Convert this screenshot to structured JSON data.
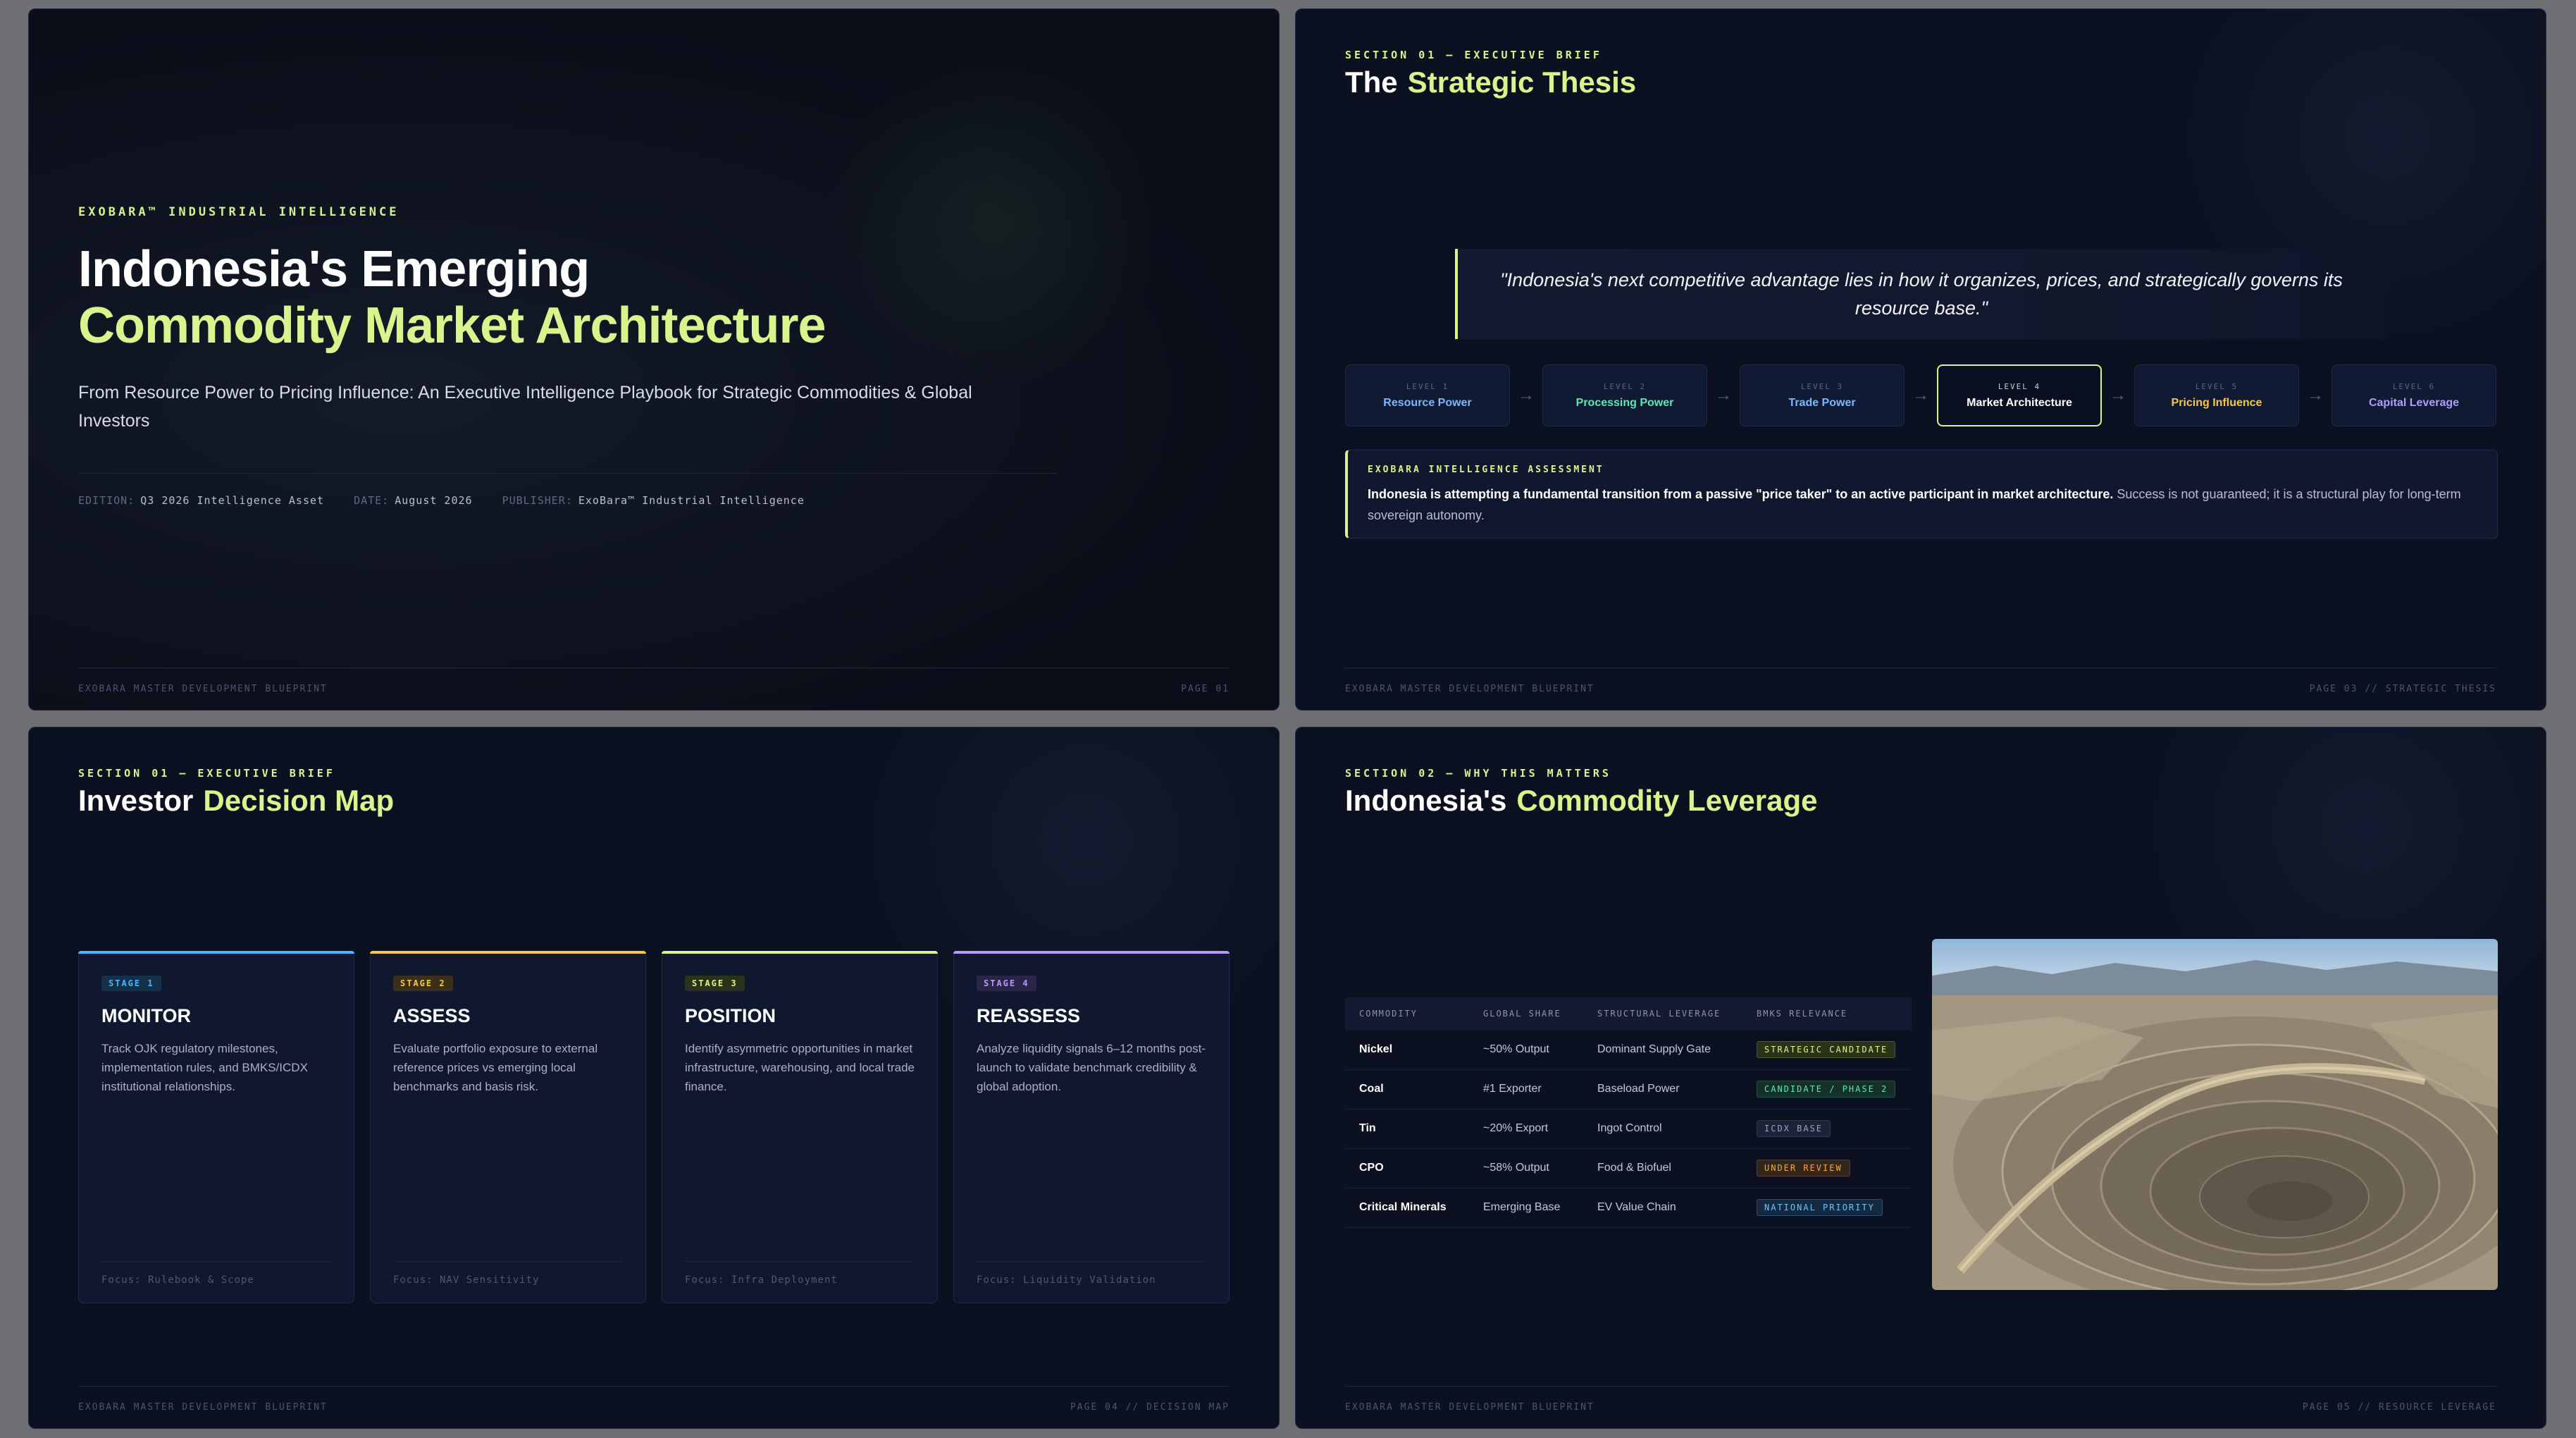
{
  "slide1": {
    "kicker": "EXOBARA™ INDUSTRIAL INTELLIGENCE",
    "title_line1": "Indonesia's Emerging",
    "title_line2": "Commodity Market Architecture",
    "lead": "From Resource Power to Pricing Influence: An Executive Intelligence Playbook for Strategic Commodities & Global Investors",
    "meta": [
      {
        "key": "EDITION:",
        "value": "Q3 2026 Intelligence Asset"
      },
      {
        "key": "DATE:",
        "value": "August 2026"
      },
      {
        "key": "PUBLISHER:",
        "value": "ExoBara™ Industrial Intelligence"
      }
    ],
    "footer_left": "EXOBARA MASTER DEVELOPMENT BLUEPRINT",
    "footer_right": "PAGE 01"
  },
  "slide2": {
    "kicker": "SECTION 01 — EXECUTIVE BRIEF",
    "title": "The",
    "title_accent": "Strategic Thesis",
    "quote": "\"Indonesia's next competitive advantage lies in how it organizes, prices, and strategically governs its resource base.\"",
    "levels": [
      {
        "level": "LEVEL 1",
        "name": "Resource Power",
        "color": "#7ab8ff"
      },
      {
        "level": "LEVEL 2",
        "name": "Processing Power",
        "color": "#5ee8b2"
      },
      {
        "level": "LEVEL 3",
        "name": "Trade Power",
        "color": "#7ab8ff"
      },
      {
        "level": "LEVEL 4",
        "name": "Market Architecture",
        "color": "#ffffff"
      },
      {
        "level": "LEVEL 5",
        "name": "Pricing Influence",
        "color": "#f5c84a"
      },
      {
        "level": "LEVEL 6",
        "name": "Capital Leverage",
        "color": "#b29bff"
      }
    ],
    "assessment": {
      "heading": "EXOBARA INTELLIGENCE ASSESSMENT",
      "bold": "Indonesia is attempting a fundamental transition from a passive \"price taker\" to an active participant in market architecture.",
      "rest": " Success is not guaranteed; it is a structural play for long-term sovereign autonomy."
    },
    "footer_left": "EXOBARA MASTER DEVELOPMENT BLUEPRINT",
    "footer_right": "PAGE 03 // STRATEGIC THESIS"
  },
  "slide3": {
    "kicker": "SECTION 01 — EXECUTIVE BRIEF",
    "title": "Investor",
    "title_accent": "Decision Map",
    "cards": [
      {
        "stage": "STAGE 1",
        "title": "MONITOR",
        "desc": "Track OJK regulatory milestones, implementation rules, and BMKS/ICDX institutional relationships.",
        "focus": "Focus: Rulebook & Scope",
        "color": "#4fb4ff"
      },
      {
        "stage": "STAGE 2",
        "title": "ASSESS",
        "desc": "Evaluate portfolio exposure to external reference prices vs emerging local benchmarks and basis risk.",
        "focus": "Focus: NAV Sensitivity",
        "color": "#f5c84a"
      },
      {
        "stage": "STAGE 3",
        "title": "POSITION",
        "desc": "Identify asymmetric opportunities in market infrastructure, warehousing, and local trade finance.",
        "focus": "Focus: Infra Deployment",
        "color": "#d7f58c"
      },
      {
        "stage": "STAGE 4",
        "title": "REASSESS",
        "desc": "Analyze liquidity signals 6–12 months post-launch to validate benchmark credibility & global adoption.",
        "focus": "Focus: Liquidity Validation",
        "color": "#b29bff"
      }
    ],
    "footer_left": "EXOBARA MASTER DEVELOPMENT BLUEPRINT",
    "footer_right": "PAGE 04 // DECISION MAP"
  },
  "slide4": {
    "kicker": "SECTION 02 — WHY THIS MATTERS",
    "title": "Indonesia's",
    "title_accent": "Commodity Leverage",
    "headers": [
      "COMMODITY",
      "GLOBAL SHARE",
      "STRUCTURAL LEVERAGE",
      "BMKS RELEVANCE"
    ],
    "rows": [
      {
        "commodity": "Nickel",
        "share": "~50% Output",
        "leverage": "Dominant Supply Gate",
        "tag": "STRATEGIC CANDIDATE",
        "tag_color": "#d7f58c",
        "tag_bg": "#2a3319"
      },
      {
        "commodity": "Coal",
        "share": "#1 Exporter",
        "leverage": "Baseload Power",
        "tag": "CANDIDATE / PHASE 2",
        "tag_color": "#5ee8b2",
        "tag_bg": "#143029"
      },
      {
        "commodity": "Tin",
        "share": "~20% Export",
        "leverage": "Ingot Control",
        "tag": "ICDX BASE",
        "tag_color": "#9aa3ba",
        "tag_bg": "#1c2338"
      },
      {
        "commodity": "CPO",
        "share": "~58% Output",
        "leverage": "Food & Biofuel",
        "tag": "UNDER REVIEW",
        "tag_color": "#f5a74a",
        "tag_bg": "#33261a"
      },
      {
        "commodity": "Critical Minerals",
        "share": "Emerging Base",
        "leverage": "EV Value Chain",
        "tag": "NATIONAL PRIORITY",
        "tag_color": "#6cc4ff",
        "tag_bg": "#152a40"
      }
    ],
    "footer_left": "EXOBARA MASTER DEVELOPMENT BLUEPRINT",
    "footer_right": "PAGE 05 // RESOURCE LEVERAGE"
  }
}
